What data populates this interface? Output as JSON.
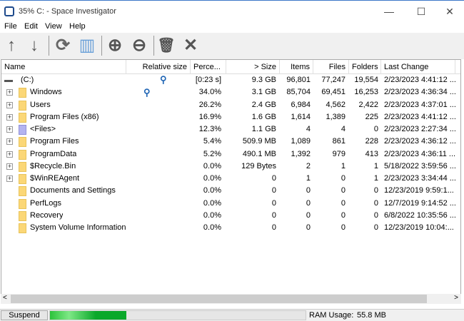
{
  "window": {
    "title": "35% C: - Space Investigator",
    "minimize": "—",
    "maximize": "☐",
    "close": "✕"
  },
  "menu": [
    "File",
    "Edit",
    "View",
    "Help"
  ],
  "toolbar": [
    {
      "name": "up-arrow-icon",
      "glyph": "↑"
    },
    {
      "name": "down-arrow-icon",
      "glyph": "↓"
    },
    {
      "name": "refresh-icon",
      "glyph": "⟳"
    },
    {
      "name": "layout-icon",
      "glyph": "▥"
    },
    {
      "name": "zoom-in-icon",
      "glyph": "⊕"
    },
    {
      "name": "zoom-out-icon",
      "glyph": "⊖"
    },
    {
      "name": "trash-icon",
      "glyph": "🗑"
    },
    {
      "name": "cancel-icon",
      "glyph": "✕"
    }
  ],
  "columns": [
    "Name",
    "Relative size",
    "Perce...",
    "> Size",
    "Items",
    "Files",
    "Folders",
    "Last Change"
  ],
  "rows": [
    {
      "name": "(C:)",
      "pct": "[0:23 s]",
      "size": "9.3 GB",
      "items": "96,801",
      "files": "77,247",
      "folders": "19,554",
      "changed": "2/23/2023  4:41:12 ..."
    },
    {
      "name": "Windows",
      "pct": "34.0%",
      "size": "3.1 GB",
      "items": "85,704",
      "files": "69,451",
      "folders": "16,253",
      "changed": "2/23/2023  4:36:34 ..."
    },
    {
      "name": "Users",
      "pct": "26.2%",
      "size": "2.4 GB",
      "items": "6,984",
      "files": "4,562",
      "folders": "2,422",
      "changed": "2/23/2023  4:37:01 ..."
    },
    {
      "name": "Program Files (x86)",
      "pct": "16.9%",
      "size": "1.6 GB",
      "items": "1,614",
      "files": "1,389",
      "folders": "225",
      "changed": "2/23/2023  4:41:12 ..."
    },
    {
      "name": "<Files>",
      "pct": "12.3%",
      "size": "1.1 GB",
      "items": "4",
      "files": "4",
      "folders": "0",
      "changed": "2/23/2023  2:27:34 ..."
    },
    {
      "name": "Program Files",
      "pct": "5.4%",
      "size": "509.9 MB",
      "items": "1,089",
      "files": "861",
      "folders": "228",
      "changed": "2/23/2023  4:36:12 ..."
    },
    {
      "name": "ProgramData",
      "pct": "5.2%",
      "size": "490.1 MB",
      "items": "1,392",
      "files": "979",
      "folders": "413",
      "changed": "2/23/2023  4:36:11 ..."
    },
    {
      "name": "$Recycle.Bin",
      "pct": "0.0%",
      "size": "129 Bytes",
      "items": "2",
      "files": "1",
      "folders": "1",
      "changed": "5/18/2022  3:59:56 ..."
    },
    {
      "name": "$WinREAgent",
      "pct": "0.0%",
      "size": "0",
      "items": "1",
      "files": "0",
      "folders": "1",
      "changed": "2/23/2023  3:34:44 ..."
    },
    {
      "name": "Documents and Settings",
      "pct": "0.0%",
      "size": "0",
      "items": "0",
      "files": "0",
      "folders": "0",
      "changed": "12/23/2019  9:59:1..."
    },
    {
      "name": "PerfLogs",
      "pct": "0.0%",
      "size": "0",
      "items": "0",
      "files": "0",
      "folders": "0",
      "changed": "12/7/2019  9:14:52 ..."
    },
    {
      "name": "Recovery",
      "pct": "0.0%",
      "size": "0",
      "items": "0",
      "files": "0",
      "folders": "0",
      "changed": "6/8/2022  10:35:56 ..."
    },
    {
      "name": "System Volume Information",
      "pct": "0.0%",
      "size": "0",
      "items": "0",
      "files": "0",
      "folders": "0",
      "changed": "12/23/2019  10:04:..."
    }
  ],
  "status": {
    "suspend": "Suspend",
    "progress_percent": 30,
    "ram_label": "RAM Usage:",
    "ram_value": "55.8 MB"
  }
}
